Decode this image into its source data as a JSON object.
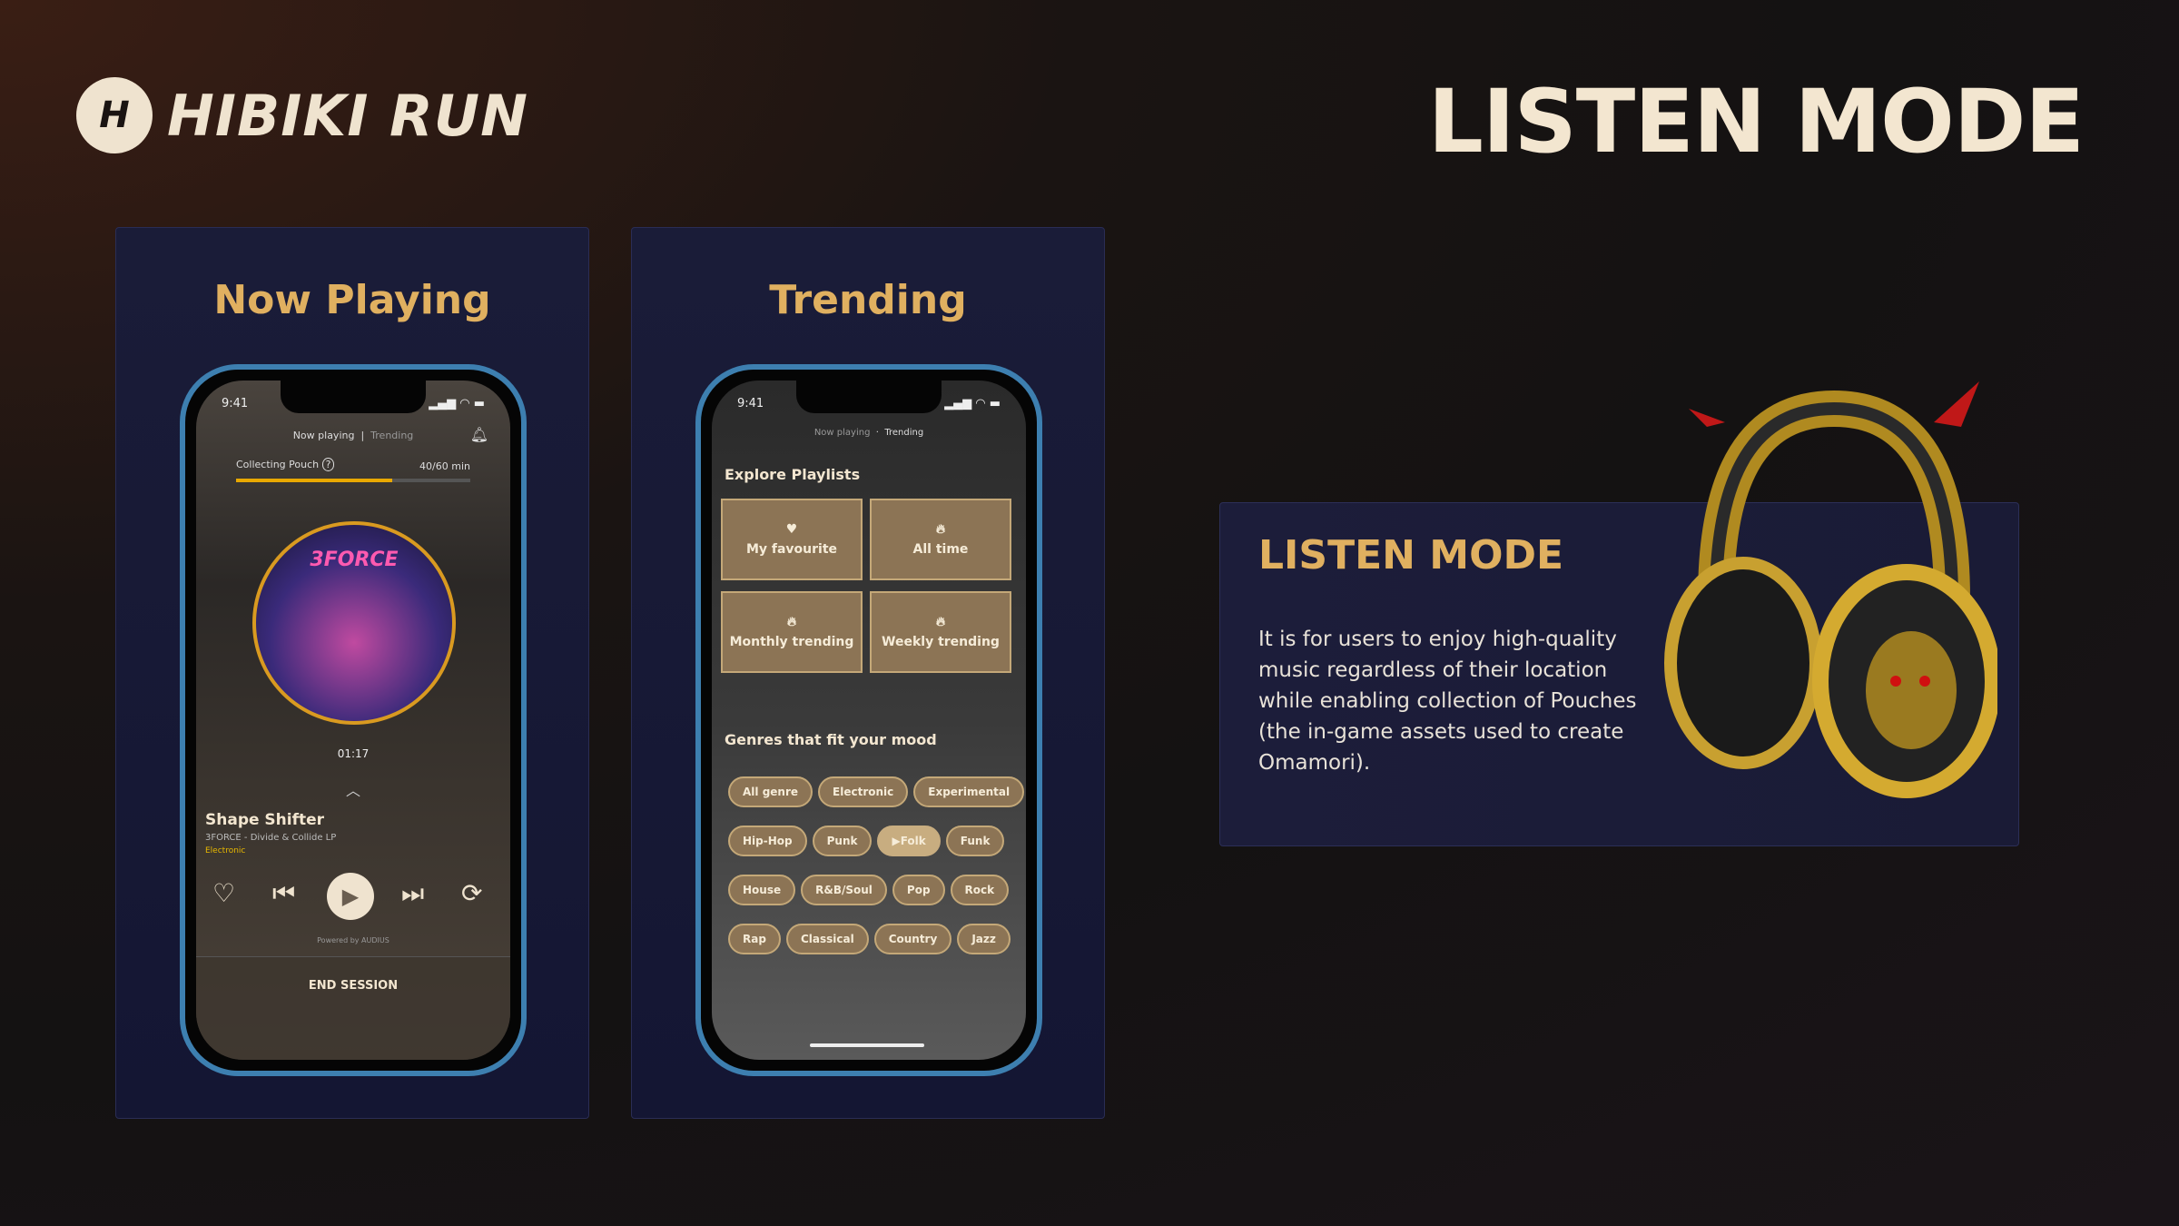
{
  "brand": {
    "name": "HIBIKI RUN",
    "mark": "H"
  },
  "page_title": "LISTEN MODE",
  "panels": [
    {
      "title": "Now Playing",
      "status_time": "9:41",
      "tabs": {
        "active": "Now playing",
        "other": "Trending"
      },
      "pouch": {
        "label": "Collecting Pouch",
        "value": "40/60 min",
        "progress": 0.667
      },
      "album_title": "3FORCE",
      "elapsed": "01:17",
      "track": {
        "title": "Shape Shifter",
        "artist_album": "3FORCE - Divide & Collide LP",
        "genre": "Electronic"
      },
      "powered_by": "Powered by AUDIUS",
      "end_session": "END SESSION"
    },
    {
      "title": "Trending",
      "status_time": "9:41",
      "tabs": {
        "other": "Now playing",
        "active": "Trending"
      },
      "explore_heading": "Explore Playlists",
      "playlists": [
        {
          "label": "My favourite",
          "icon": "heart-icon"
        },
        {
          "label": "All time",
          "icon": "flame-icon"
        },
        {
          "label": "Monthly trending",
          "icon": "flame-icon"
        },
        {
          "label": "Weekly trending",
          "icon": "flame-icon"
        }
      ],
      "genres_heading": "Genres that fit your mood",
      "genres": [
        [
          "All genre",
          "Electronic",
          "Experimental"
        ],
        [
          "Hip-Hop",
          "Punk",
          "Folk",
          "Funk"
        ],
        [
          "House",
          "R&B/Soul",
          "Pop",
          "Rock"
        ],
        [
          "Rap",
          "Classical",
          "Country",
          "Jazz"
        ]
      ],
      "selected_genre": "Folk"
    }
  ],
  "card": {
    "title": "LISTEN MODE",
    "body": "It is for users to enjoy high-quality music regardless of their location while enabling collection of Pouches (the in-game assets used to create Omamori)."
  },
  "colors": {
    "accent": "#e0b060",
    "chip": "#8c7455",
    "phone_frame": "#3d7fb0",
    "panel": "#1a1c38"
  }
}
